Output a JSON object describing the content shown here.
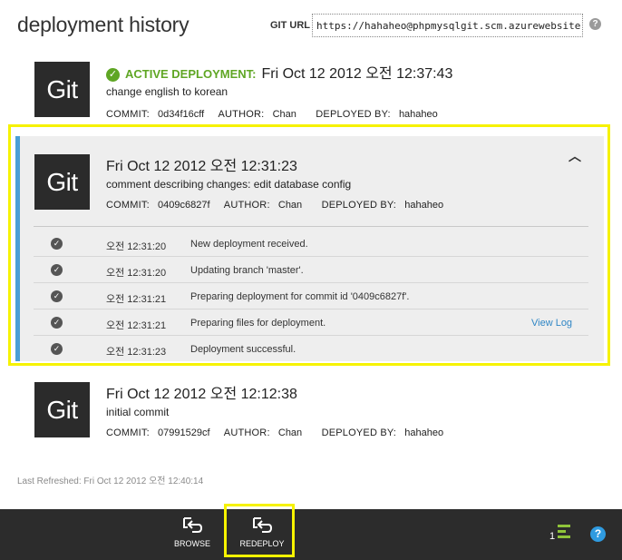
{
  "header": {
    "title": "deployment history",
    "git_url_label": "GIT URL",
    "git_url_value": "https://hahaheo@phpmysqlgit.scm.azurewebsite",
    "help_symbol": "?"
  },
  "logo_text": "Git",
  "labels": {
    "commit": "COMMIT:",
    "author": "AUTHOR:",
    "deployed_by": "DEPLOYED BY:"
  },
  "deployments": [
    {
      "status": "ACTIVE DEPLOYMENT:",
      "date": "Fri Oct 12 2012 오전 12:37:43",
      "message": "change english to korean",
      "commit": "0d34f16cff",
      "author": "Chan",
      "deployed_by": "hahaheo"
    },
    {
      "date": "Fri Oct 12 2012 오전 12:31:23",
      "message": "comment describing changes: edit database config",
      "commit": "0409c6827f",
      "author": "Chan",
      "deployed_by": "hahaheo",
      "log": [
        {
          "time": "오전 12:31:20",
          "text": "New deployment received."
        },
        {
          "time": "오전 12:31:20",
          "text": "Updating branch 'master'."
        },
        {
          "time": "오전 12:31:21",
          "text": "Preparing deployment for commit id '0409c6827f'."
        },
        {
          "time": "오전 12:31:21",
          "text": "Preparing files for deployment.",
          "link": "View Log"
        },
        {
          "time": "오전 12:31:23",
          "text": "Deployment successful."
        }
      ]
    },
    {
      "date": "Fri Oct 12 2012 오전 12:12:38",
      "message": "initial commit",
      "commit": "07991529cf",
      "author": "Chan",
      "deployed_by": "hahaheo"
    }
  ],
  "last_refreshed": "Last Refreshed: Fri Oct 12 2012 오전 12:40:14",
  "command_bar": {
    "browse_label": "BROWSE",
    "redeploy_label": "REDEPLOY",
    "count": "1",
    "help_symbol": "?"
  },
  "colors": {
    "active_green": "#5fa624",
    "accent_blue": "#4b9fd5",
    "highlight_yellow": "#f6f200",
    "command_bar_bg": "#2c2c2c"
  }
}
